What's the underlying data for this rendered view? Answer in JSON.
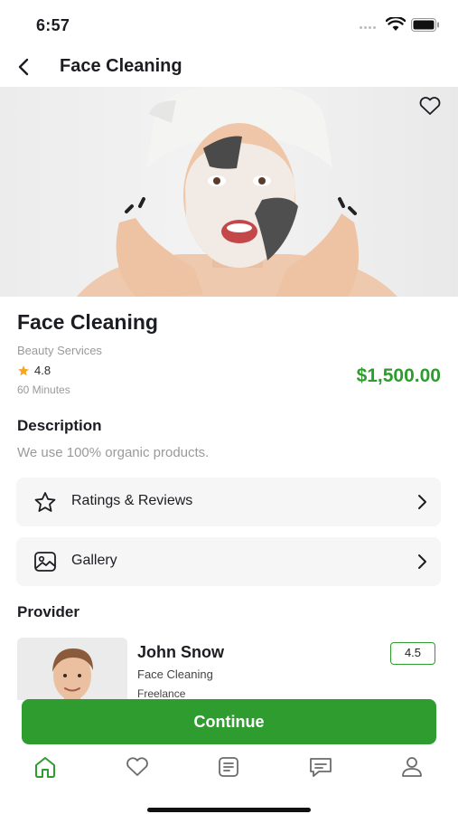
{
  "status_bar": {
    "time": "6:57"
  },
  "header": {
    "title": "Face Cleaning"
  },
  "service": {
    "title": "Face Cleaning",
    "category": "Beauty Services",
    "rating": "4.8",
    "duration": "60 Minutes",
    "price": "$1,500.00"
  },
  "description": {
    "heading": "Description",
    "text": "We use 100% organic products."
  },
  "rows": {
    "ratings_label": "Ratings & Reviews",
    "gallery_label": "Gallery"
  },
  "provider": {
    "heading": "Provider",
    "name": "John Snow",
    "service": "Face Cleaning",
    "type": "Freelance",
    "rating": "4.5"
  },
  "continue_label": "Continue",
  "tabbar": {
    "items": [
      "home-icon",
      "heart-icon",
      "bookings-icon",
      "chat-icon",
      "profile-icon"
    ],
    "active": "home-icon"
  },
  "colors": {
    "accent": "#2e9c2e",
    "star": "#f5a623",
    "text": "#1c1d22",
    "muted": "#9a9a9a"
  }
}
